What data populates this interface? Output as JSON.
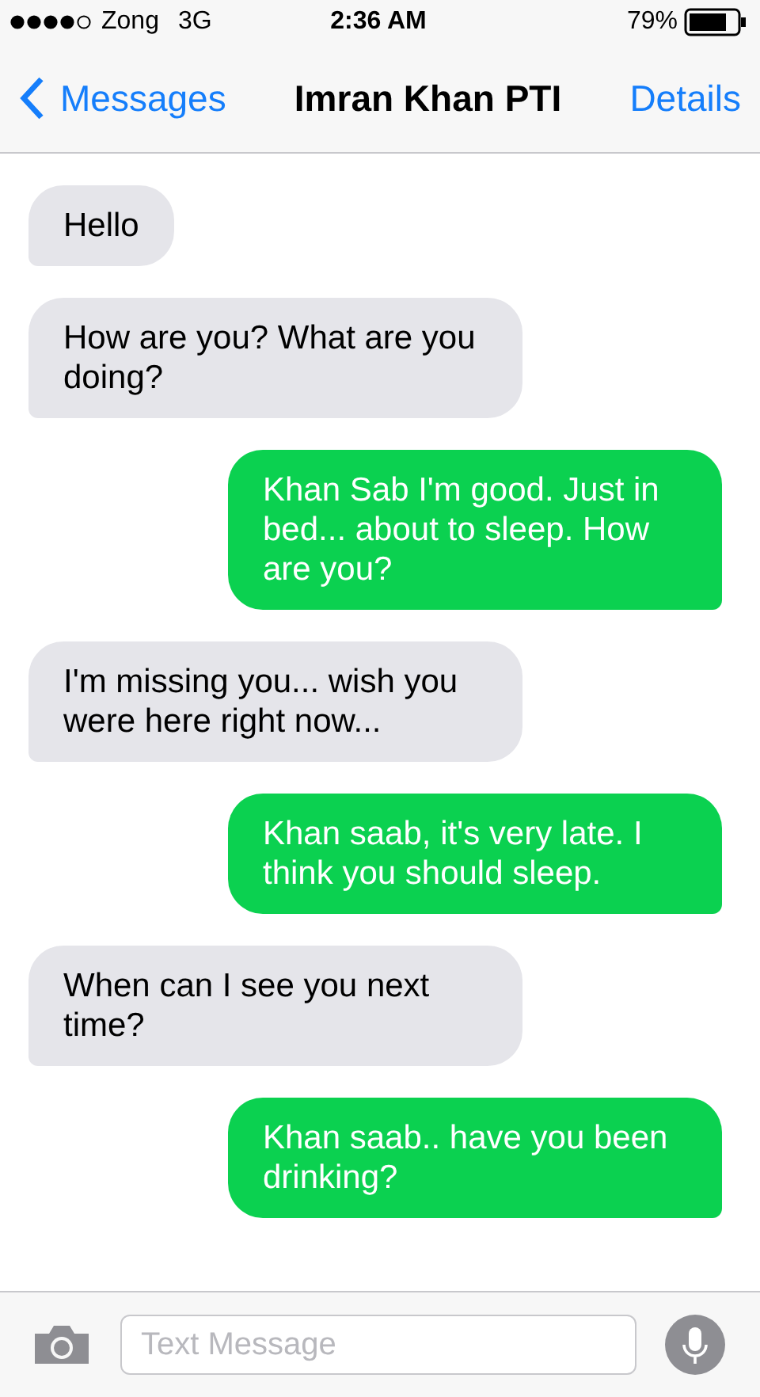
{
  "status_bar": {
    "carrier": "Zong",
    "network": "3G",
    "time": "2:36 AM",
    "battery": "79%"
  },
  "nav": {
    "back": "Messages",
    "title": "Imran Khan PTI",
    "action": "Details"
  },
  "messages": [
    {
      "kind": "received",
      "text": "Hello"
    },
    {
      "kind": "received",
      "text": "How are you? What are you doing?"
    },
    {
      "kind": "sent",
      "text": "Khan Sab I'm good. Just in bed... about to sleep. How are you?"
    },
    {
      "kind": "received",
      "text": "I'm missing you... wish you were here right now..."
    },
    {
      "kind": "sent",
      "text": "Khan saab, it's very late. I think you should sleep."
    },
    {
      "kind": "received",
      "text": "When can I see you next time?"
    },
    {
      "kind": "sent",
      "text": "Khan saab.. have you been drinking?"
    }
  ],
  "composer": {
    "placeholder": "Text Message"
  }
}
